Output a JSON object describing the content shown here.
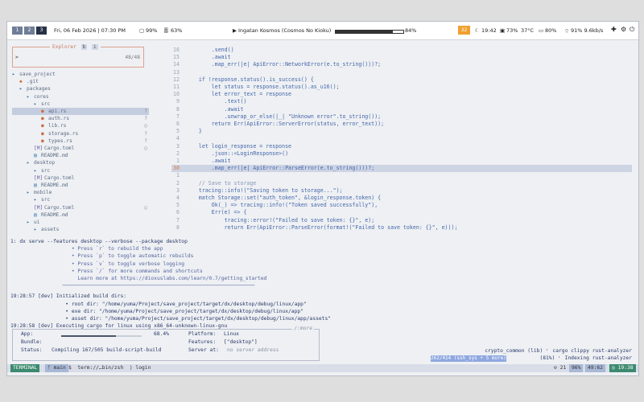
{
  "topbar": {
    "workspaces": [
      "1",
      "2",
      "3"
    ],
    "datetime": "Fri, 06 Feb 2026 | 07:30 PM",
    "cpu": "99%",
    "mem": "63%",
    "media_title": "Ingatan Kosmos (Cosmos No Kioku)",
    "media_progress": 0.84,
    "media_progress_label": "84%",
    "badge": "32",
    "time": "19:42",
    "disk": "73%",
    "temp": "37°C",
    "battery": "80%",
    "wifi": "91% 9.6kb/s"
  },
  "explorer": {
    "title": "Explorer",
    "tabs": [
      "b",
      "i"
    ],
    "count": "48/48",
    "prompt": ">",
    "items": [
      {
        "label": "save_project",
        "depth": 0,
        "kind": "dir",
        "status": ""
      },
      {
        "label": ".git",
        "depth": 1,
        "kind": "git",
        "status": ""
      },
      {
        "label": "packages",
        "depth": 1,
        "kind": "dir",
        "status": ""
      },
      {
        "label": "cores",
        "depth": 2,
        "kind": "dir",
        "status": ""
      },
      {
        "label": "src",
        "depth": 3,
        "kind": "dir",
        "status": ""
      },
      {
        "label": "api.rs",
        "depth": 4,
        "kind": "rs",
        "status": "?"
      },
      {
        "label": "auth.rs",
        "depth": 4,
        "kind": "rs",
        "status": "?"
      },
      {
        "label": "lib.rs",
        "depth": 4,
        "kind": "rs",
        "status": "○"
      },
      {
        "label": "storage.rs",
        "depth": 4,
        "kind": "rs",
        "status": "?"
      },
      {
        "label": "types.rs",
        "depth": 4,
        "kind": "rs",
        "status": "?"
      },
      {
        "label": "Cargo.toml",
        "depth": 3,
        "kind": "toml",
        "status": "○"
      },
      {
        "label": "README.md",
        "depth": 3,
        "kind": "md",
        "status": ""
      },
      {
        "label": "desktop",
        "depth": 2,
        "kind": "dir",
        "status": ""
      },
      {
        "label": "src",
        "depth": 3,
        "kind": "dir",
        "status": ""
      },
      {
        "label": "Cargo.toml",
        "depth": 3,
        "kind": "toml",
        "status": ""
      },
      {
        "label": "README.md",
        "depth": 3,
        "kind": "md",
        "status": ""
      },
      {
        "label": "mobile",
        "depth": 2,
        "kind": "dir",
        "status": ""
      },
      {
        "label": "src",
        "depth": 3,
        "kind": "dir",
        "status": ""
      },
      {
        "label": "Cargo.toml",
        "depth": 3,
        "kind": "toml",
        "status": "○"
      },
      {
        "label": "README.md",
        "depth": 3,
        "kind": "md",
        "status": ""
      },
      {
        "label": "ui",
        "depth": 2,
        "kind": "dir",
        "status": ""
      },
      {
        "label": "assets",
        "depth": 3,
        "kind": "dir",
        "status": ""
      }
    ]
  },
  "editor": {
    "current_line": "30",
    "lines": [
      {
        "n": "16",
        "t": "        .send()"
      },
      {
        "n": "15",
        "t": "        .await"
      },
      {
        "n": "14",
        "t": "        .map_err(|e| ApiError::NetworkError(e.to_string()))?;"
      },
      {
        "n": "13",
        "t": ""
      },
      {
        "n": "12",
        "t": "    if !response.status().is_success() {"
      },
      {
        "n": "11",
        "t": "        let status = response.status().as_u16();"
      },
      {
        "n": "10",
        "t": "        let error_text = response"
      },
      {
        "n": "9",
        "t": "            .text()"
      },
      {
        "n": "8",
        "t": "            .await"
      },
      {
        "n": "7",
        "t": "            .unwrap_or_else(|_| \"Unknown error\".to_string());"
      },
      {
        "n": "6",
        "t": "        return Err(ApiError::ServerError(status, error_text));"
      },
      {
        "n": "5",
        "t": "    }"
      },
      {
        "n": "4",
        "t": ""
      },
      {
        "n": "3",
        "t": "    let login_response = response"
      },
      {
        "n": "2",
        "t": "        .json::<LoginResponse>()"
      },
      {
        "n": "1",
        "t": "        .await"
      },
      {
        "n": "30",
        "t": "        .map_err(|e| ApiError::ParseError(e.to_string()))?;"
      },
      {
        "n": "1",
        "t": ""
      },
      {
        "n": "2",
        "t": "    // Save to storage"
      },
      {
        "n": "3",
        "t": "    tracing::info!(\"Saving token to storage...\");"
      },
      {
        "n": "4",
        "t": "    match Storage::set(\"auth_token\", &login_response.token) {"
      },
      {
        "n": "5",
        "t": "        Ok(_) => tracing::info!(\"Token saved successfully\"),"
      },
      {
        "n": "6",
        "t": "        Err(e) => {"
      },
      {
        "n": "7",
        "t": "            tracing::error!(\"Failed to save token: {}\", e);"
      },
      {
        "n": "8",
        "t": "            return Err(ApiError::ParseError(format!(\"Failed to save token: {}\", e)));"
      }
    ]
  },
  "terminal": {
    "lines": [
      {
        "t": "1: dx serve --features desktop --verbose --package desktop",
        "dim": false
      },
      {
        "t": "                    • Press `r` to rebuild the app",
        "dim": true
      },
      {
        "t": "                    • Press `p` to toggle automatic rebuilds",
        "dim": true
      },
      {
        "t": "                    • Press `v` to toggle verbose logging",
        "dim": true
      },
      {
        "t": "                    • Press `/` for more commands and shortcuts",
        "dim": true
      },
      {
        "t": "                      Learn more at https://dioxuslabs.com/learn/0.7/getting_started",
        "dim": true
      },
      {
        "t": "                 ───────────────────────────────────────────────────────────────",
        "dim": true
      },
      {
        "t": "19:28:57 [dev] Initialized build dirs:",
        "dim": false
      },
      {
        "t": "                  • root dir: \"/home/yuma/Project/save_project/target/dx/desktop/debug/linux/app\"",
        "dim": false
      },
      {
        "t": "                  • exe dir: \"/home/yuma/Project/save_project/target/dx/desktop/debug/linux/app\"",
        "dim": false
      },
      {
        "t": "                  • asset dir: \"/home/yuma/Project/save_project/target/dx/desktop/debug/linux/app/assets\"",
        "dim": false
      },
      {
        "t": "19:28:58 [dev] Executing cargo for linux using x86_64-unknown-linux-gnu",
        "dim": false
      }
    ],
    "info": {
      "more": "/:more",
      "app_label": "App:",
      "app_progress": 0.68,
      "app_pct": "68.4%",
      "bundle_label": "Bundle:",
      "status_label": "Status:",
      "status_value": "Compiling 167/505 build-script-build",
      "platform_label": "Platform:",
      "platform_value": "Linux",
      "features_label": "Features:",
      "features_value": "[\"desktop\"]",
      "server_label": "Server at:",
      "server_value": "no server address"
    },
    "right1": "crypto_common (lib) ⠂ cargo clippy rust-analyzer",
    "progress_label": "262/414 (ssh_sys + 5 more)",
    "right2": "(81%) ⠂ Indexing rust-analyzer"
  },
  "statusline": {
    "mode": "TERMINAL",
    "branch": "ᚠ main",
    "path": "$  term://…bin/zsh  ⟩ login",
    "diag": "⊙ 21",
    "pct": "96%",
    "pos": "49:62",
    "time": "◷ 19:38"
  },
  "colors": {
    "accent": "#3c8a70",
    "cursorline": "#cdd4e4",
    "code": "#4466aa"
  }
}
